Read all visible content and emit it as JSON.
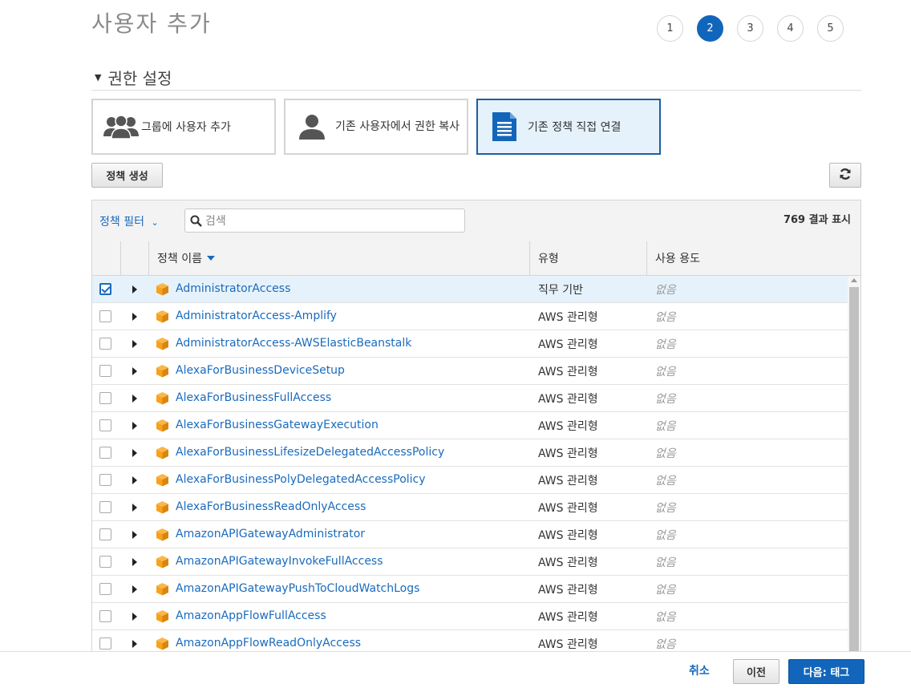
{
  "header": {
    "title": "사용자 추가"
  },
  "steps": [
    "1",
    "2",
    "3",
    "4",
    "5"
  ],
  "active_step": "2",
  "section": {
    "title": "권한 설정"
  },
  "options": [
    {
      "label": "그룹에 사용자 추가",
      "icon": "group-icon",
      "selected": false
    },
    {
      "label": "기존 사용자에서 권한 복사",
      "icon": "user-icon",
      "selected": false
    },
    {
      "label": "기존 정책 직접 연결",
      "icon": "document-icon",
      "selected": true
    }
  ],
  "toolbar": {
    "create_policy": "정책 생성",
    "refresh_icon": "refresh-icon"
  },
  "filter": {
    "label": "정책 필터",
    "search_placeholder": "검색",
    "result_count": "769 결과 표시"
  },
  "table": {
    "columns": {
      "name": "정책 이름",
      "type": "유형",
      "usage": "사용 용도"
    },
    "rows": [
      {
        "name": "AdministratorAccess",
        "type": "직무 기반",
        "usage": "없음",
        "checked": true
      },
      {
        "name": "AdministratorAccess-Amplify",
        "type": "AWS 관리형",
        "usage": "없음",
        "checked": false
      },
      {
        "name": "AdministratorAccess-AWSElasticBeanstalk",
        "type": "AWS 관리형",
        "usage": "없음",
        "checked": false
      },
      {
        "name": "AlexaForBusinessDeviceSetup",
        "type": "AWS 관리형",
        "usage": "없음",
        "checked": false
      },
      {
        "name": "AlexaForBusinessFullAccess",
        "type": "AWS 관리형",
        "usage": "없음",
        "checked": false
      },
      {
        "name": "AlexaForBusinessGatewayExecution",
        "type": "AWS 관리형",
        "usage": "없음",
        "checked": false
      },
      {
        "name": "AlexaForBusinessLifesizeDelegatedAccessPolicy",
        "type": "AWS 관리형",
        "usage": "없음",
        "checked": false
      },
      {
        "name": "AlexaForBusinessPolyDelegatedAccessPolicy",
        "type": "AWS 관리형",
        "usage": "없음",
        "checked": false
      },
      {
        "name": "AlexaForBusinessReadOnlyAccess",
        "type": "AWS 관리형",
        "usage": "없음",
        "checked": false
      },
      {
        "name": "AmazonAPIGatewayAdministrator",
        "type": "AWS 관리형",
        "usage": "없음",
        "checked": false
      },
      {
        "name": "AmazonAPIGatewayInvokeFullAccess",
        "type": "AWS 관리형",
        "usage": "없음",
        "checked": false
      },
      {
        "name": "AmazonAPIGatewayPushToCloudWatchLogs",
        "type": "AWS 관리형",
        "usage": "없음",
        "checked": false
      },
      {
        "name": "AmazonAppFlowFullAccess",
        "type": "AWS 관리형",
        "usage": "없음",
        "checked": false
      },
      {
        "name": "AmazonAppFlowReadOnlyAccess",
        "type": "AWS 관리형",
        "usage": "없음",
        "checked": false
      }
    ]
  },
  "footer": {
    "cancel": "취소",
    "previous": "이전",
    "next": "다음: 태그"
  },
  "colors": {
    "accent": "#1166bb",
    "link": "#1a6bbd",
    "selected_bg": "#e6f2fb",
    "cube": "#f7a21b"
  }
}
